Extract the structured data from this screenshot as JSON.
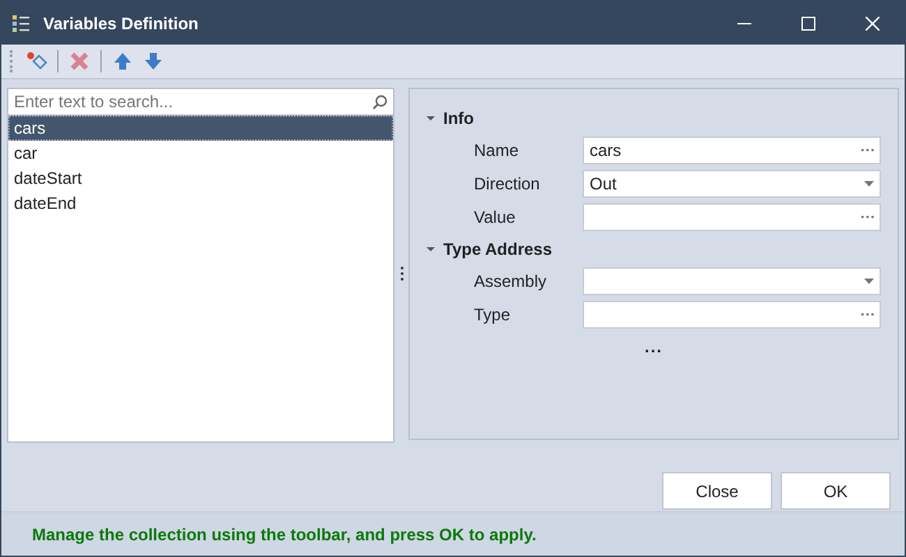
{
  "window": {
    "title": "Variables Definition"
  },
  "toolbar": [
    {
      "kind": "add"
    },
    {
      "kind": "separator"
    },
    {
      "kind": "delete",
      "disabled": true
    },
    {
      "kind": "separator"
    },
    {
      "kind": "up"
    },
    {
      "kind": "down"
    }
  ],
  "search": {
    "placeholder": "Enter text to search..."
  },
  "list": [
    {
      "label": "cars",
      "selected": true
    },
    {
      "label": "car",
      "selected": false
    },
    {
      "label": "dateStart",
      "selected": false
    },
    {
      "label": "dateEnd",
      "selected": false
    }
  ],
  "properties": [
    {
      "category": "Info",
      "expanded": true,
      "rows": [
        {
          "label": "Name",
          "value": "cars",
          "kind": "ellipsis"
        },
        {
          "label": "Direction",
          "value": "Out",
          "kind": "dropdown"
        },
        {
          "label": "Value",
          "value": "",
          "kind": "ellipsis"
        }
      ]
    },
    {
      "category": "Type Address",
      "expanded": true,
      "rows": [
        {
          "label": "Assembly",
          "value": "",
          "kind": "dropdown"
        },
        {
          "label": "Type",
          "value": "",
          "kind": "ellipsis"
        }
      ]
    }
  ],
  "more": "...",
  "buttons": [
    "Close",
    "OK"
  ],
  "status_bar": "Manage the collection using the toolbar, and press OK to apply."
}
